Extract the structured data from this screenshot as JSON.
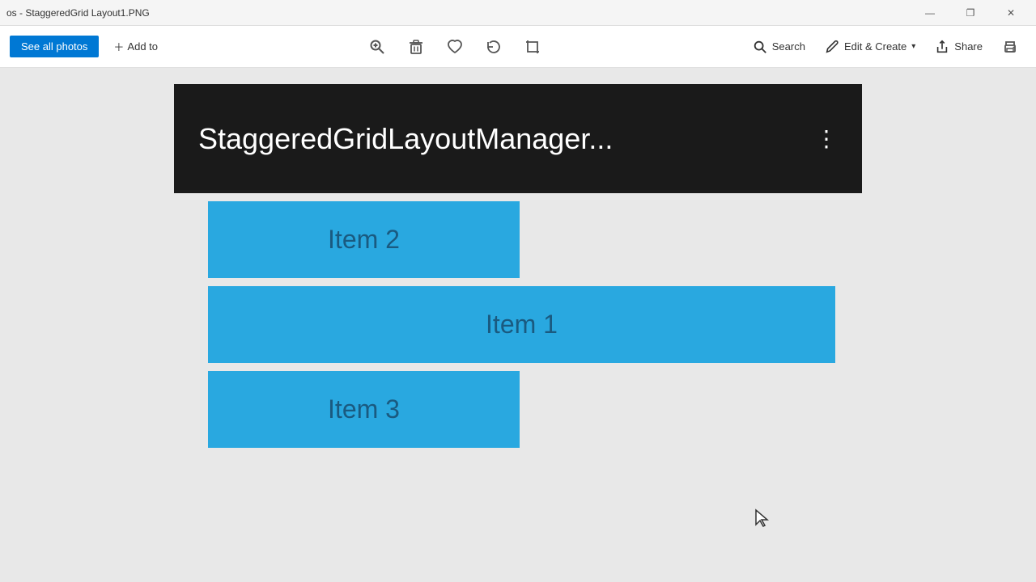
{
  "titlebar": {
    "title": "os - StaggeredGrid Layout1.PNG",
    "minimize": "—",
    "maximize": "❐",
    "close": "✕"
  },
  "toolbar": {
    "see_all_photos": "See all photos",
    "add_to": "Add to",
    "search_label": "Search",
    "edit_create_label": "Edit & Create",
    "share_label": "Share",
    "zoom_icon": "🔍",
    "delete_icon": "🗑",
    "heart_icon": "♡",
    "rotate_icon": "↺",
    "crop_icon": "⬜",
    "printer_icon": "🖨",
    "chevron_down": "▾"
  },
  "app": {
    "title": "StaggeredGridLayoutManager...",
    "menu_dots": "⋮",
    "items": [
      {
        "label": "Item 2",
        "id": "item-2"
      },
      {
        "label": "Item 1",
        "id": "item-1"
      },
      {
        "label": "Item 3",
        "id": "item-3"
      }
    ]
  }
}
